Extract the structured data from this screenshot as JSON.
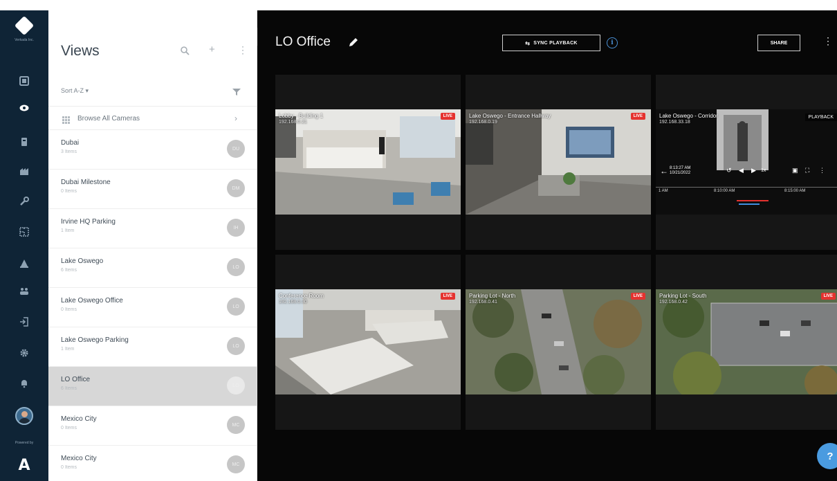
{
  "colors": {
    "rail_bg": "#0f2436",
    "main_bg": "#070707",
    "live_badge": "#e5322f",
    "info_accent": "#4a8fd4",
    "help_button": "#4a9be0",
    "selected_row": "#d7d7d7"
  },
  "nav_rail": {
    "logo_subtext": "Verkada Inc.",
    "powered_by": "Powered by",
    "powered_logo": "A",
    "icons": [
      "dashboard-icon",
      "cameras-icon",
      "sites-icon",
      "buildings-icon",
      "tools-icon",
      "floorplan-icon",
      "alarms-icon",
      "people-icon",
      "access-icon",
      "settings-icon",
      "notifications-icon"
    ]
  },
  "sidebar": {
    "title": "Views",
    "sort_label": "Sort A-Z ▾",
    "browse_label": "Browse All Cameras",
    "browse_chevron": "›",
    "add_symbol": "+",
    "more_symbol": "⋮",
    "views": [
      {
        "name": "Dubai",
        "count": "3 Items",
        "badge": "DU"
      },
      {
        "name": "Dubai Milestone",
        "count": "0 Items",
        "badge": "DM"
      },
      {
        "name": "Irvine HQ Parking",
        "count": "1 Item",
        "badge": "IH"
      },
      {
        "name": "Lake Oswego",
        "count": "6 Items",
        "badge": "LO"
      },
      {
        "name": "Lake Oswego Office",
        "count": "0 Items",
        "badge": "LO"
      },
      {
        "name": "Lake Oswego Parking",
        "count": "1 Item",
        "badge": "LO"
      },
      {
        "name": "LO Office",
        "count": "6 Items",
        "badge": "LO"
      },
      {
        "name": "Mexico City",
        "count": "0 Items",
        "badge": "MC"
      },
      {
        "name": "Mexico City",
        "count": "0 Items",
        "badge": "MC"
      }
    ],
    "selected_index": 6
  },
  "main": {
    "view_title": "LO Office",
    "sync_button": "SYNC PLAYBACK",
    "share_button": "SHARE",
    "more_symbol": "⋮",
    "info_symbol": "i",
    "help_symbol": "?"
  },
  "tiles": [
    {
      "name": "Lobby - Building 1",
      "ip": "192.168.0.21",
      "status": "LIVE",
      "scene": "lobby"
    },
    {
      "name": "Lake Oswego - Entrance Hallway",
      "ip": "192.168.0.19",
      "status": "LIVE",
      "scene": "entrance"
    },
    {
      "name": "Lake Oswego - Corridor",
      "ip": "192.168.33.18",
      "status": "PLAYBACK",
      "scene": "corridor",
      "playback": {
        "time": "8:13:27 AM",
        "date": "10/21/2022",
        "ticks": [
          "1 AM",
          "8:10:00 AM",
          "8:15:00 AM"
        ]
      }
    },
    {
      "name": "Conference Room",
      "ip": "192.168.0.30",
      "status": "LIVE",
      "scene": "conference"
    },
    {
      "name": "Parking Lot - North",
      "ip": "192.168.0.41",
      "status": "LIVE",
      "scene": "aerial1"
    },
    {
      "name": "Parking Lot - South",
      "ip": "192.168.0.42",
      "status": "LIVE",
      "scene": "aerial2"
    }
  ]
}
